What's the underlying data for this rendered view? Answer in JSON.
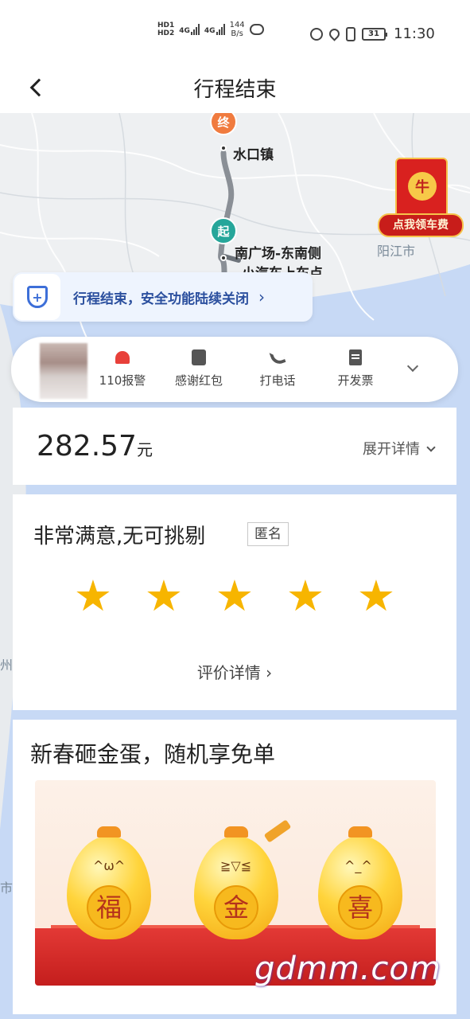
{
  "status_bar": {
    "hd1": "HD1",
    "hd2": "HD2",
    "net1": "4G",
    "net2": "4G",
    "speed_value": "144",
    "speed_unit": "B/s",
    "battery": "31",
    "time": "11:30"
  },
  "header": {
    "title": "行程结束"
  },
  "map": {
    "end_marker": "终",
    "start_marker": "起",
    "destination": "水口镇",
    "origin_line1": "南广场-东南侧",
    "origin_line2": "小汽车上车点",
    "city_right": "阳江市",
    "city_left1": "州市",
    "city_left2": "市"
  },
  "red_packet": {
    "coin": "牛",
    "label": "点我领车费"
  },
  "safety": {
    "icon_char": "+",
    "text": "行程结束，安全功能陆续关闭",
    "arrow": "›"
  },
  "actions": {
    "items": [
      {
        "label": "110报警",
        "icon": "alarm-icon"
      },
      {
        "label": "感谢红包",
        "icon": "red-packet-icon"
      },
      {
        "label": "打电话",
        "icon": "phone-icon"
      },
      {
        "label": "开发票",
        "icon": "invoice-icon"
      }
    ]
  },
  "fare": {
    "amount": "282.57",
    "unit": "元",
    "detail_label": "展开详情"
  },
  "rating": {
    "title": "非常满意,无可挑剔",
    "anonymous_tag": "匿名",
    "stars": 5,
    "star_glyph": "★",
    "detail_label": "评价详情 ›"
  },
  "promo": {
    "title": "新春砸金蛋，随机享免单",
    "eggs": [
      "福",
      "金",
      "喜"
    ],
    "faces": [
      "^ω^",
      "≧▽≦",
      "^_^"
    ]
  },
  "watermark": "gdmm.com",
  "colors": {
    "accent_blue": "#2b4f9e",
    "star": "#f7b500",
    "end_marker": "#f07b3f",
    "start_marker": "#26a69a",
    "alarm": "#e8403a"
  }
}
